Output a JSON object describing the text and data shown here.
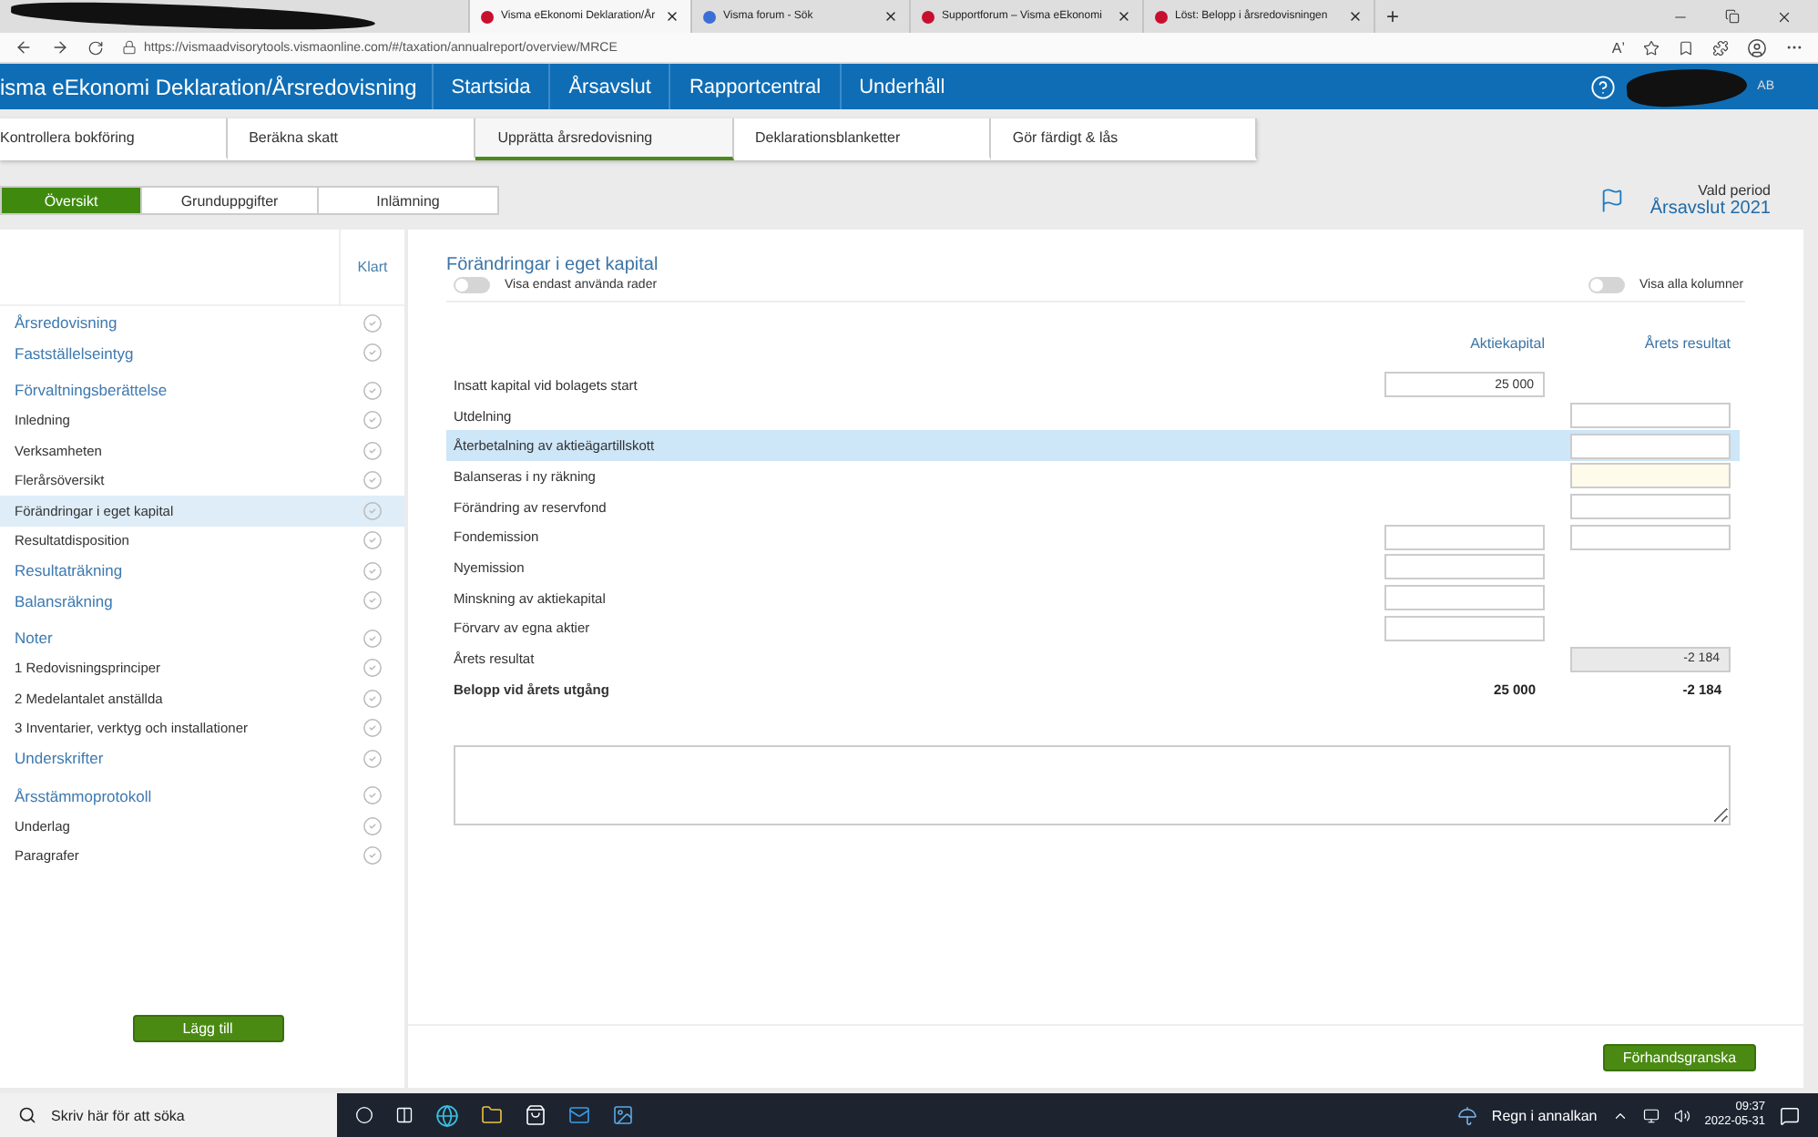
{
  "browser": {
    "tabs": [
      {
        "kind": "redacted",
        "selected": false
      },
      {
        "kind": "page",
        "title": "Visma eEkonomi Deklaration/År",
        "selected": true
      },
      {
        "kind": "page",
        "title": "Visma forum - Sök",
        "selected": false
      },
      {
        "kind": "page",
        "title": "Supportforum – Visma eEkonomi",
        "selected": false
      },
      {
        "kind": "page",
        "title": "Löst: Belopp i årsredovisningen",
        "selected": false
      }
    ],
    "new_tab": "+",
    "url": "https://vismaadvisorytools.vismaonline.com/#/taxation/annualreport/overview/MRCE",
    "reader_mode": "Aʼ"
  },
  "app": {
    "title": "isma eEkonomi Deklaration/Årsredovisning",
    "nav": [
      "Startsida",
      "Årsavslut",
      "Rapportcentral",
      "Underhåll"
    ],
    "account_suffix": "AB"
  },
  "steps": [
    {
      "label": "Kontrollera bokföring",
      "selected": false
    },
    {
      "label": "Beräkna skatt",
      "selected": false
    },
    {
      "label": "Upprätta årsredovisning",
      "selected": true
    },
    {
      "label": "Deklarationsblanketter",
      "selected": false
    },
    {
      "label": "Gör färdigt & lås",
      "selected": false
    }
  ],
  "subtabs": [
    {
      "label": "Översikt",
      "selected": true
    },
    {
      "label": "Grunduppgifter",
      "selected": false
    },
    {
      "label": "Inlämning",
      "selected": false
    }
  ],
  "period": {
    "label": "Vald period",
    "value": "Årsavslut 2021"
  },
  "sidebar": {
    "header": "Klart",
    "add_button": "Lägg till",
    "items": [
      {
        "label": "Årsredovisning",
        "selected": false
      },
      {
        "label": "Fastställelseintyg",
        "selected": false
      },
      {
        "label": "Förvaltningsberättelse",
        "selected": false,
        "children": [
          {
            "label": "Inledning",
            "selected": false
          },
          {
            "label": "Verksamheten",
            "selected": false
          },
          {
            "label": "Flerårsöversikt",
            "selected": false
          },
          {
            "label": "Förändringar i eget kapital",
            "selected": true
          },
          {
            "label": "Resultatdisposition",
            "selected": false
          }
        ]
      },
      {
        "label": "Resultaträkning",
        "selected": false
      },
      {
        "label": "Balansräkning",
        "selected": false
      },
      {
        "label": "Noter",
        "selected": false,
        "children": [
          {
            "label": "1 Redovisningsprinciper",
            "selected": false
          },
          {
            "label": "2 Medelantalet anställda",
            "selected": false
          },
          {
            "label": "3 Inventarier, verktyg och installationer",
            "selected": false
          }
        ]
      },
      {
        "label": "Underskrifter",
        "selected": false
      },
      {
        "label": "Årsstämmoprotokoll",
        "selected": false,
        "children": [
          {
            "label": "Underlag",
            "selected": false
          },
          {
            "label": "Paragrafer",
            "selected": false
          }
        ]
      }
    ]
  },
  "main": {
    "title": "Förändringar i eget kapital",
    "toggles": [
      {
        "label": "Visa endast använda rader",
        "on": false
      },
      {
        "label": "Visa alla kolumner",
        "on": false
      }
    ],
    "columns": [
      "Aktiekapital",
      "Årets resultat"
    ],
    "rows": [
      {
        "label": "Insatt kapital vid bolagets start",
        "kind": "row",
        "selected": false,
        "cells": [
          {
            "kind": "input",
            "value": "25 000"
          },
          {
            "kind": "none"
          }
        ]
      },
      {
        "label": "Utdelning",
        "kind": "row",
        "selected": false,
        "cells": [
          {
            "kind": "none"
          },
          {
            "kind": "input"
          }
        ]
      },
      {
        "label": "Återbetalning av aktieägartillskott",
        "kind": "row",
        "selected": true,
        "cells": [
          {
            "kind": "none"
          },
          {
            "kind": "input"
          }
        ]
      },
      {
        "label": "Balanseras i ny räkning",
        "kind": "row",
        "selected": false,
        "cells": [
          {
            "kind": "none"
          },
          {
            "kind": "input",
            "marked": true
          }
        ]
      },
      {
        "label": "Förändring av reservfond",
        "kind": "row",
        "selected": false,
        "cells": [
          {
            "kind": "none"
          },
          {
            "kind": "input"
          }
        ]
      },
      {
        "label": "Fondemission",
        "kind": "row",
        "selected": false,
        "cells": [
          {
            "kind": "input"
          },
          {
            "kind": "input"
          }
        ]
      },
      {
        "label": "Nyemission",
        "kind": "row",
        "selected": false,
        "cells": [
          {
            "kind": "input"
          },
          {
            "kind": "none"
          }
        ]
      },
      {
        "label": "Minskning av aktiekapital",
        "kind": "row",
        "selected": false,
        "cells": [
          {
            "kind": "input"
          },
          {
            "kind": "none"
          }
        ]
      },
      {
        "label": "Förvarv av egna aktier",
        "kind": "row",
        "selected": false,
        "cells": [
          {
            "kind": "input"
          },
          {
            "kind": "none"
          }
        ]
      },
      {
        "label": "Årets resultat",
        "kind": "row",
        "selected": false,
        "cells": [
          {
            "kind": "none"
          },
          {
            "kind": "readonly",
            "value": "-2 184"
          }
        ]
      },
      {
        "label": "Belopp vid årets utgång",
        "kind": "total",
        "selected": false,
        "cells": [
          {
            "kind": "text",
            "value": "25 000"
          },
          {
            "kind": "text",
            "value": "-2 184"
          }
        ]
      }
    ],
    "preview_button": "Förhandsgranska"
  },
  "taskbar": {
    "search_placeholder": "Skriv här för att söka",
    "weather": "Regn i annalkan",
    "time": "09:37",
    "date": "2022-05-31"
  }
}
